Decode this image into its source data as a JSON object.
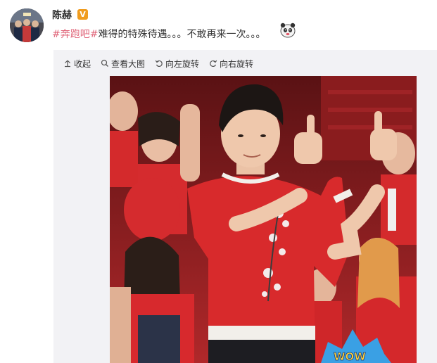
{
  "post": {
    "author": "陈赫",
    "verified_badge": "V",
    "hashtag": "#奔跑吧#",
    "text": "难得的特殊待遇。。。不敢再来一次。。。",
    "hashtag_color": "#e0667a"
  },
  "toolbar": {
    "collapse_label": "收起",
    "view_large_label": "查看大图",
    "rotate_left_label": "向左旋转",
    "rotate_right_label": "向右旋转"
  },
  "photo": {
    "badge_text": "WOW"
  },
  "colors": {
    "verified_badge": "#f09c1e",
    "panel_bg": "#f2f2f5",
    "shirt_red": "#d82a2c"
  }
}
